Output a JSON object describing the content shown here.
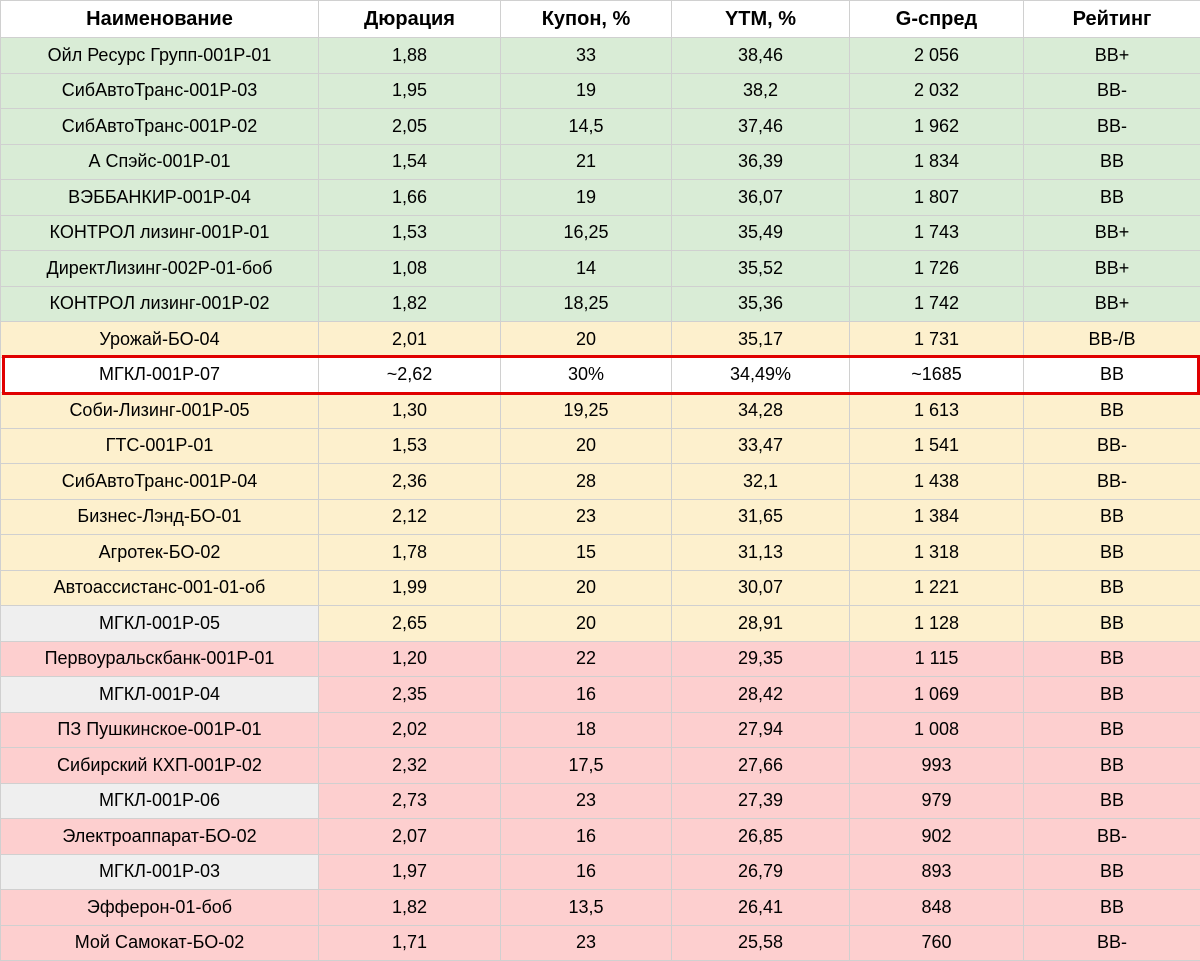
{
  "colors": {
    "green": "#d9ecd6",
    "yellow": "#fdf0cd",
    "red": "#fdcfcf",
    "gray": "#efefef",
    "highlight_border": "#e00000"
  },
  "headers": [
    "Наименование",
    "Дюрация",
    "Купон, %",
    "YTM, %",
    "G-спред",
    "Рейтинг"
  ],
  "rows": [
    {
      "style": "green",
      "cells": [
        "Ойл Ресурс Групп-001Р-01",
        "1,88",
        "33",
        "38,46",
        "2 056",
        "BB+"
      ]
    },
    {
      "style": "green",
      "cells": [
        "СибАвтоТранс-001Р-03",
        "1,95",
        "19",
        "38,2",
        "2 032",
        "BB-"
      ]
    },
    {
      "style": "green",
      "cells": [
        "СибАвтоТранс-001Р-02",
        "2,05",
        "14,5",
        "37,46",
        "1 962",
        "BB-"
      ]
    },
    {
      "style": "green",
      "cells": [
        "А Спэйс-001Р-01",
        "1,54",
        "21",
        "36,39",
        "1 834",
        "BB"
      ]
    },
    {
      "style": "green",
      "cells": [
        "ВЭББАНКИР-001Р-04",
        "1,66",
        "19",
        "36,07",
        "1 807",
        "BB"
      ]
    },
    {
      "style": "green",
      "cells": [
        "КОНТРОЛ лизинг-001Р-01",
        "1,53",
        "16,25",
        "35,49",
        "1 743",
        "BB+"
      ]
    },
    {
      "style": "green",
      "cells": [
        "ДиректЛизинг-002Р-01-боб",
        "1,08",
        "14",
        "35,52",
        "1 726",
        "BB+"
      ]
    },
    {
      "style": "green",
      "cells": [
        "КОНТРОЛ лизинг-001Р-02",
        "1,82",
        "18,25",
        "35,36",
        "1 742",
        "BB+"
      ]
    },
    {
      "style": "yellow",
      "cells": [
        "Урожай-БО-04",
        "2,01",
        "20",
        "35,17",
        "1 731",
        "BB-/B"
      ]
    },
    {
      "style": "white",
      "cells": [
        "МГКЛ-001Р-07",
        "~2,62",
        "30%",
        "34,49%",
        "~1685",
        "BB"
      ]
    },
    {
      "style": "yellow",
      "cells": [
        "Соби-Лизинг-001Р-05",
        "1,30",
        "19,25",
        "34,28",
        "1 613",
        "BB"
      ]
    },
    {
      "style": "yellow",
      "cells": [
        "ГТС-001Р-01",
        "1,53",
        "20",
        "33,47",
        "1 541",
        "BB-"
      ]
    },
    {
      "style": "yellow",
      "cells": [
        "СибАвтоТранс-001Р-04",
        "2,36",
        "28",
        "32,1",
        "1 438",
        "BB-"
      ]
    },
    {
      "style": "yellow",
      "cells": [
        "Бизнес-Лэнд-БО-01",
        "2,12",
        "23",
        "31,65",
        "1 384",
        "BB"
      ]
    },
    {
      "style": "yellow",
      "cells": [
        "Агротек-БО-02",
        "1,78",
        "15",
        "31,13",
        "1 318",
        "BB"
      ]
    },
    {
      "style": "yellow",
      "cells": [
        "Автоассистанс-001-01-об",
        "1,99",
        "20",
        "30,07",
        "1 221",
        "BB"
      ]
    },
    {
      "style": "gray",
      "cells": [
        "МГКЛ-001Р-05",
        "2,65",
        "20",
        "28,91",
        "1 128",
        "BB"
      ]
    },
    {
      "style": "red",
      "cells": [
        "Первоуральскбанк-001Р-01",
        "1,20",
        "22",
        "29,35",
        "1 115",
        "BB"
      ]
    },
    {
      "style": "graypink",
      "cells": [
        "МГКЛ-001Р-04",
        "2,35",
        "16",
        "28,42",
        "1 069",
        "BB"
      ]
    },
    {
      "style": "red",
      "cells": [
        "ПЗ Пушкинское-001Р-01",
        "2,02",
        "18",
        "27,94",
        "1 008",
        "BB"
      ]
    },
    {
      "style": "red",
      "cells": [
        "Сибирский КХП-001Р-02",
        "2,32",
        "17,5",
        "27,66",
        "993",
        "BB"
      ]
    },
    {
      "style": "graypink",
      "cells": [
        "МГКЛ-001Р-06",
        "2,73",
        "23",
        "27,39",
        "979",
        "BB"
      ]
    },
    {
      "style": "red",
      "cells": [
        "Электроаппарат-БО-02",
        "2,07",
        "16",
        "26,85",
        "902",
        "BB-"
      ]
    },
    {
      "style": "graypink",
      "cells": [
        "МГКЛ-001Р-03",
        "1,97",
        "16",
        "26,79",
        "893",
        "BB"
      ]
    },
    {
      "style": "red",
      "cells": [
        "Эфферон-01-боб",
        "1,82",
        "13,5",
        "26,41",
        "848",
        "BB"
      ]
    },
    {
      "style": "red",
      "cells": [
        "Мой Самокат-БО-02",
        "1,71",
        "23",
        "25,58",
        "760",
        "BB-"
      ]
    }
  ]
}
